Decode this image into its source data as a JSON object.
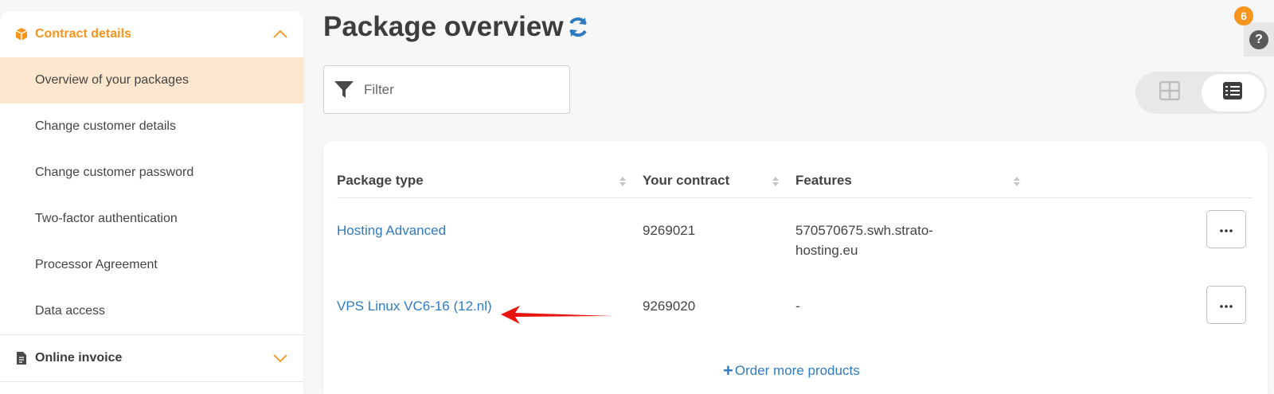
{
  "sidebar": {
    "contract_section": {
      "label": "Contract details",
      "icon": "box-icon",
      "expanded": true
    },
    "items": [
      {
        "label": "Overview of your packages",
        "selected": true
      },
      {
        "label": "Change customer details",
        "selected": false
      },
      {
        "label": "Change customer password",
        "selected": false
      },
      {
        "label": "Two-factor authentication",
        "selected": false
      },
      {
        "label": "Processor Agreement",
        "selected": false
      },
      {
        "label": "Data access",
        "selected": false
      }
    ],
    "invoice_section": {
      "label": "Online invoice",
      "icon": "document-icon",
      "expanded": false
    }
  },
  "header": {
    "title": "Package overview"
  },
  "filter": {
    "placeholder": "Filter"
  },
  "notifications": {
    "count": "6"
  },
  "help": {
    "label": "?"
  },
  "view_toggle": {
    "options": [
      "grid-view",
      "list-view"
    ],
    "active": "list-view"
  },
  "table": {
    "columns": [
      "Package type",
      "Your contract",
      "Features"
    ],
    "rows": [
      {
        "package": "Hosting Advanced",
        "contract": "9269021",
        "features": "570570675.swh.strato-hosting.eu",
        "features_line1": "570570675.swh.strato-",
        "features_line2": "hosting.eu",
        "more": "..."
      },
      {
        "package": "VPS Linux VC6-16 (12.nl)",
        "contract": "9269020",
        "features": "-",
        "features_line1": "-",
        "features_line2": "",
        "more": "..."
      }
    ],
    "order_more": "Order more products"
  },
  "colors": {
    "accent": "#f7941d",
    "link": "#2f7bbf",
    "selected_bg": "#fde7cf",
    "annotation_arrow": "#e8140f"
  }
}
